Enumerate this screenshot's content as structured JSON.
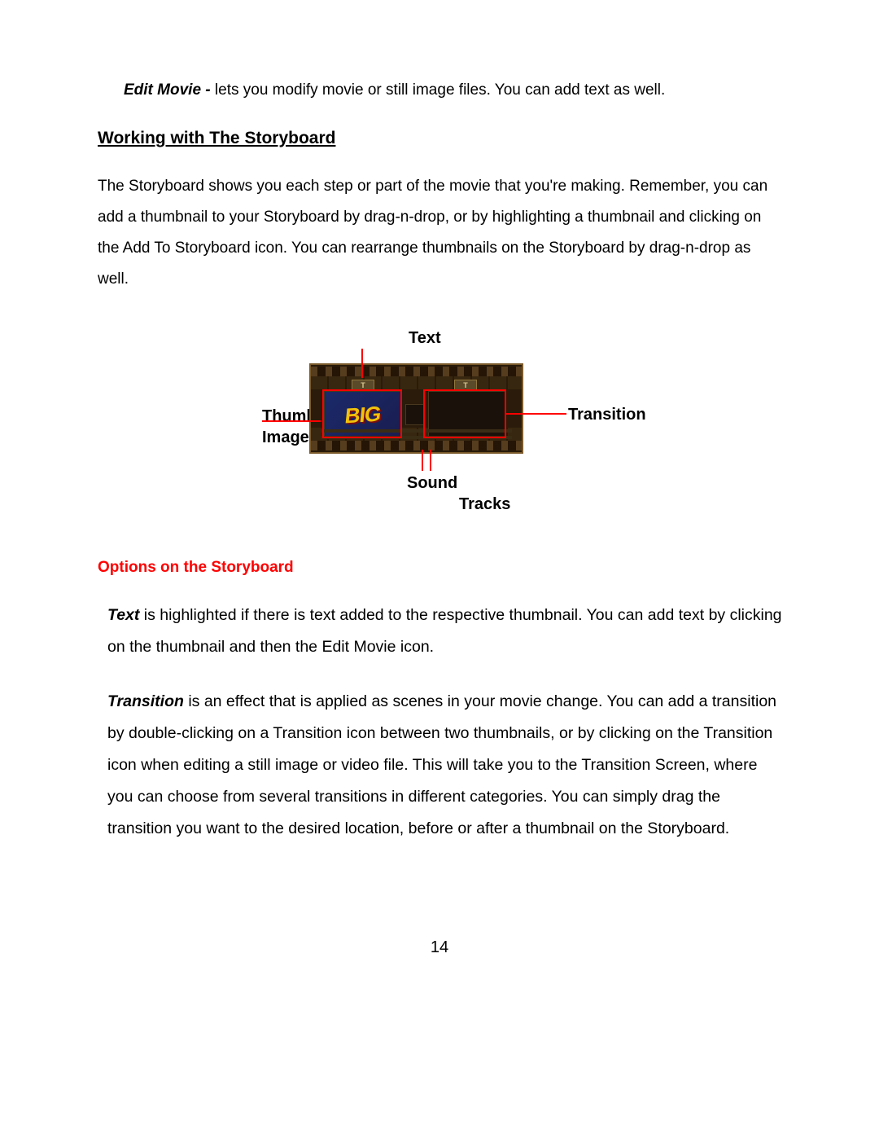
{
  "intro": {
    "label": "Edit Movie - ",
    "text": "lets you modify movie or still image files. You can add text as well."
  },
  "heading": "Working with The Storyboard",
  "storyboard_para": "The Storyboard shows you each step or part of the movie that you're making. Remember, you can add a thumbnail to your Storyboard by drag-n-drop, or by highlighting a thumbnail and clicking on the Add To Storyboard icon. You can rearrange thumbnails on the Storyboard by drag-n-drop as well.",
  "figure": {
    "callouts": {
      "text": "Text",
      "thumbnail_line1": "Thumbnail",
      "thumbnail_line2": "Image",
      "transition": "Transition",
      "sound_line1": "Sound",
      "sound_line2": "Tracks"
    },
    "tab_letter": "T",
    "big_thumb_text": "BIG"
  },
  "options_heading": "Options on the Storyboard",
  "option_text": {
    "label": "Text",
    "body": " is highlighted if there is text added to the respective thumbnail. You can add text by clicking on the thumbnail and then the Edit Movie icon."
  },
  "option_transition": {
    "label": "Transition",
    "body": " is an effect that is applied as scenes in your movie change. You can add a transition by double-clicking on a Transition icon between two thumbnails, or by clicking on the Transition icon when editing a still image or video file. This will take you to the Transition Screen, where you can choose from several transitions in different categories. You can simply drag the transition you want to the desired location, before or after a thumbnail on the Storyboard."
  },
  "page_number": "14"
}
